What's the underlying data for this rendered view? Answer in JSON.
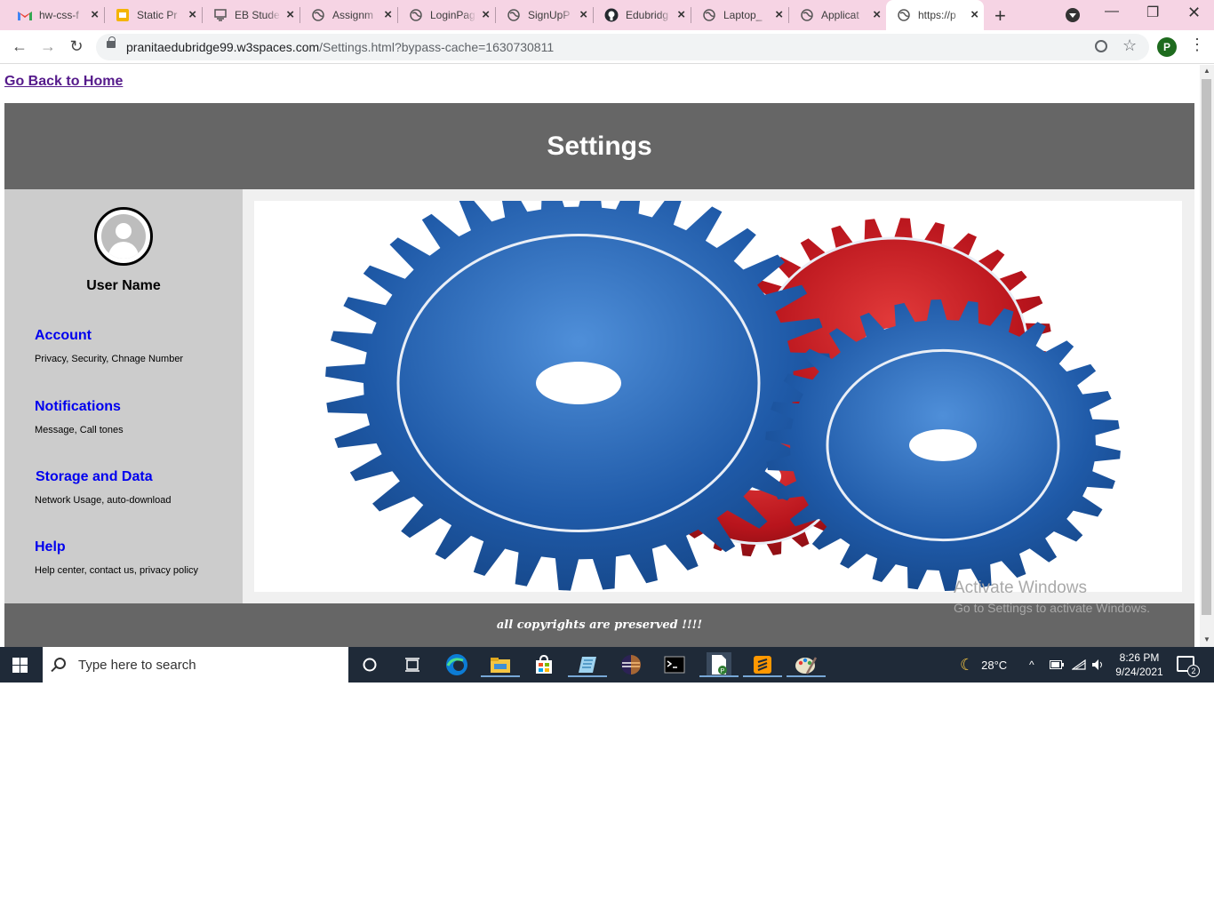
{
  "browser": {
    "tabs": [
      {
        "title": "hw-css-f",
        "icon": "gmail-icon",
        "active": false
      },
      {
        "title": "Static Pr",
        "icon": "slides-icon",
        "active": false
      },
      {
        "title": "EB Stude",
        "icon": "eb-icon",
        "active": false
      },
      {
        "title": "Assignm",
        "icon": "globe-icon",
        "active": false
      },
      {
        "title": "LoginPag",
        "icon": "globe-icon",
        "active": false
      },
      {
        "title": "SignUpP",
        "icon": "globe-icon",
        "active": false
      },
      {
        "title": "Edubridg",
        "icon": "github-icon",
        "active": false
      },
      {
        "title": "Laptop_",
        "icon": "globe-icon",
        "active": false
      },
      {
        "title": "Applicat",
        "icon": "globe-icon",
        "active": false
      },
      {
        "title": "https://p",
        "icon": "globe-icon",
        "active": true
      }
    ],
    "url_host": "pranitaedubridge99.w3spaces.com",
    "url_path": "/Settings.html?bypass-cache=1630730811",
    "profile_initial": "P"
  },
  "page": {
    "home_link": "Go Back to Home",
    "title": "Settings",
    "user_name": "User Name",
    "menu": [
      {
        "title": "Account",
        "desc": "Privacy, Security, Chnage Number"
      },
      {
        "title": "Notifications",
        "desc": "Message, Call tones"
      },
      {
        "title": "Storage and Data",
        "desc": "Network Usage, auto-download"
      },
      {
        "title": "Help",
        "desc": "Help center, contact us, privacy policy"
      }
    ],
    "footer": "all copyrights are preserved !!!!",
    "colors": {
      "header": "#666666",
      "sidebar": "#cccccc",
      "link": "#0000ee",
      "gear_blue": "#1f5aa8",
      "gear_red": "#b8141c"
    }
  },
  "watermark": {
    "line1": "Activate Windows",
    "line2": "Go to Settings to activate Windows."
  },
  "taskbar": {
    "search_placeholder": "Type here to search",
    "temperature": "28°C",
    "time": "8:26 PM",
    "date": "9/24/2021",
    "notification_count": "2"
  }
}
